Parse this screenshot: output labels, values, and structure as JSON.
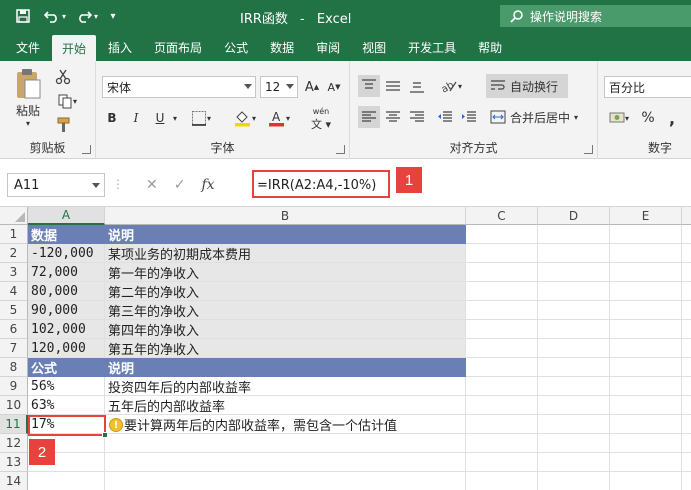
{
  "window": {
    "title": "IRR函数",
    "app": "Excel",
    "separator": "-",
    "search_label": "操作说明搜索"
  },
  "tabs": [
    {
      "label": "文件",
      "active": false
    },
    {
      "label": "开始",
      "active": true
    },
    {
      "label": "插入",
      "active": false
    },
    {
      "label": "页面布局",
      "active": false
    },
    {
      "label": "公式",
      "active": false
    },
    {
      "label": "数据",
      "active": false
    },
    {
      "label": "审阅",
      "active": false
    },
    {
      "label": "视图",
      "active": false
    },
    {
      "label": "开发工具",
      "active": false
    },
    {
      "label": "帮助",
      "active": false
    }
  ],
  "ribbon": {
    "clipboard": {
      "label": "剪贴板",
      "paste": "粘贴"
    },
    "font": {
      "label": "字体",
      "name": "宋体",
      "size": "12",
      "bold": "B",
      "italic": "I",
      "underline": "U",
      "grow": "A",
      "shrink": "A",
      "phonetic": "wén"
    },
    "alignment": {
      "label": "对齐方式",
      "wrap": "自动换行",
      "merge": "合并后居中"
    },
    "number": {
      "label": "数字",
      "format": "百分比",
      "percent": "%",
      "comma": ","
    }
  },
  "formula_bar": {
    "name_box": "A11",
    "cancel": "✕",
    "enter": "✓",
    "fx": "fx",
    "formula": "=IRR(A2:A4,-10%)",
    "badge": "1"
  },
  "sheet": {
    "columns": [
      "A",
      "B",
      "C",
      "D",
      "E"
    ],
    "rows": [
      "1",
      "2",
      "3",
      "4",
      "5",
      "6",
      "7",
      "8",
      "9",
      "10",
      "11",
      "12",
      "13",
      "14"
    ],
    "cells": [
      {
        "a": "数据",
        "b": "说明"
      },
      {
        "a": "-120,000",
        "b": "某项业务的初期成本费用"
      },
      {
        "a": "72,000",
        "b": "第一年的净收入"
      },
      {
        "a": "80,000",
        "b": "第二年的净收入"
      },
      {
        "a": "90,000",
        "b": "第三年的净收入"
      },
      {
        "a": "102,000",
        "b": "第四年的净收入"
      },
      {
        "a": "120,000",
        "b": "第五年的净收入"
      },
      {
        "a": "公式",
        "b": "说明"
      },
      {
        "a": "56%",
        "b": "投资四年后的内部收益率"
      },
      {
        "a": "63%",
        "b": "五年后的内部收益率"
      },
      {
        "a": "17%",
        "b": "要计算两年后的内部收益率，需包含一个估计值"
      },
      {
        "a": "",
        "b": ""
      },
      {
        "a": "",
        "b": ""
      },
      {
        "a": "",
        "b": ""
      }
    ],
    "warning_icon": "!",
    "badge": "2"
  }
}
